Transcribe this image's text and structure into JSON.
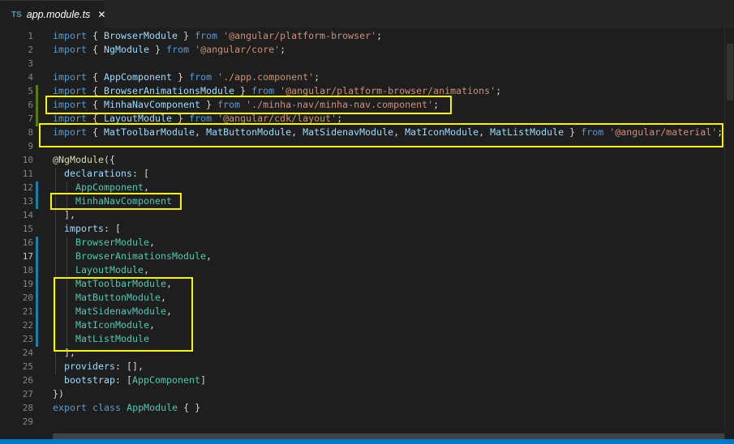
{
  "tab": {
    "lang_badge": "TS",
    "filename": "app.module.ts",
    "close_glyph": "✕"
  },
  "lines": [
    {
      "n": "1",
      "tokens": [
        [
          "k",
          "import"
        ],
        [
          "p",
          " { "
        ],
        [
          "v",
          "BrowserModule"
        ],
        [
          "p",
          " } "
        ],
        [
          "k",
          "from"
        ],
        [
          "p",
          " "
        ],
        [
          "s",
          "'@angular/platform-browser'"
        ],
        [
          "p",
          ";"
        ]
      ]
    },
    {
      "n": "2",
      "tokens": [
        [
          "k",
          "import"
        ],
        [
          "p",
          " { "
        ],
        [
          "v",
          "NgModule"
        ],
        [
          "p",
          " } "
        ],
        [
          "k",
          "from"
        ],
        [
          "p",
          " "
        ],
        [
          "s",
          "'@angular/core'"
        ],
        [
          "p",
          ";"
        ]
      ]
    },
    {
      "n": "3",
      "tokens": []
    },
    {
      "n": "4",
      "tokens": [
        [
          "k",
          "import"
        ],
        [
          "p",
          " { "
        ],
        [
          "v",
          "AppComponent"
        ],
        [
          "p",
          " } "
        ],
        [
          "k",
          "from"
        ],
        [
          "p",
          " "
        ],
        [
          "s",
          "'./app.component'"
        ],
        [
          "p",
          ";"
        ]
      ]
    },
    {
      "n": "5",
      "tokens": [
        [
          "k",
          "import"
        ],
        [
          "p",
          " { "
        ],
        [
          "v",
          "BrowserAnimationsModule"
        ],
        [
          "p",
          " } "
        ],
        [
          "k",
          "from"
        ],
        [
          "p",
          " "
        ],
        [
          "s",
          "'@angular/platform-browser/animations'"
        ],
        [
          "p",
          ";"
        ]
      ]
    },
    {
      "n": "6",
      "tokens": [
        [
          "k",
          "import"
        ],
        [
          "p",
          " { "
        ],
        [
          "v",
          "MinhaNavComponent"
        ],
        [
          "p",
          " } "
        ],
        [
          "k",
          "from"
        ],
        [
          "p",
          " "
        ],
        [
          "s",
          "'./minha-nav/minha-nav.component'"
        ],
        [
          "p",
          ";"
        ]
      ]
    },
    {
      "n": "7",
      "tokens": [
        [
          "k",
          "import"
        ],
        [
          "p",
          " { "
        ],
        [
          "v",
          "LayoutModule"
        ],
        [
          "p",
          " } "
        ],
        [
          "k",
          "from"
        ],
        [
          "p",
          " "
        ],
        [
          "s",
          "'@angular/cdk/layout'"
        ],
        [
          "p",
          ";"
        ]
      ]
    },
    {
      "n": "8",
      "tokens": [
        [
          "k",
          "import"
        ],
        [
          "p",
          " { "
        ],
        [
          "v",
          "MatToolbarModule"
        ],
        [
          "p",
          ", "
        ],
        [
          "v",
          "MatButtonModule"
        ],
        [
          "p",
          ", "
        ],
        [
          "v",
          "MatSidenavModule"
        ],
        [
          "p",
          ", "
        ],
        [
          "v",
          "MatIconModule"
        ],
        [
          "p",
          ", "
        ],
        [
          "v",
          "MatListModule"
        ],
        [
          "p",
          " } "
        ],
        [
          "k",
          "from"
        ],
        [
          "p",
          " "
        ],
        [
          "s",
          "'@angular/material'"
        ],
        [
          "p",
          ";"
        ]
      ]
    },
    {
      "n": "9",
      "tokens": []
    },
    {
      "n": "10",
      "tokens": [
        [
          "f",
          "@NgModule"
        ],
        [
          "p",
          "({"
        ]
      ]
    },
    {
      "n": "11",
      "tokens": [
        [
          "p",
          "  "
        ],
        [
          "v",
          "declarations"
        ],
        [
          "p",
          ": ["
        ]
      ]
    },
    {
      "n": "12",
      "tokens": [
        [
          "p",
          "    "
        ],
        [
          "t",
          "AppComponent"
        ],
        [
          "p",
          ","
        ]
      ]
    },
    {
      "n": "13",
      "tokens": [
        [
          "p",
          "    "
        ],
        [
          "t",
          "MinhaNavComponent"
        ]
      ]
    },
    {
      "n": "14",
      "tokens": [
        [
          "p",
          "  ],"
        ]
      ]
    },
    {
      "n": "15",
      "tokens": [
        [
          "p",
          "  "
        ],
        [
          "v",
          "imports"
        ],
        [
          "p",
          ": ["
        ]
      ]
    },
    {
      "n": "16",
      "tokens": [
        [
          "p",
          "    "
        ],
        [
          "t",
          "BrowserModule"
        ],
        [
          "p",
          ","
        ]
      ]
    },
    {
      "n": "17",
      "tokens": [
        [
          "p",
          "    "
        ],
        [
          "t",
          "BrowserAnimationsModule"
        ],
        [
          "p",
          ","
        ]
      ]
    },
    {
      "n": "18",
      "tokens": [
        [
          "p",
          "    "
        ],
        [
          "t",
          "LayoutModule"
        ],
        [
          "p",
          ","
        ]
      ]
    },
    {
      "n": "19",
      "tokens": [
        [
          "p",
          "    "
        ],
        [
          "t",
          "MatToolbarModule"
        ],
        [
          "p",
          ","
        ]
      ]
    },
    {
      "n": "20",
      "tokens": [
        [
          "p",
          "    "
        ],
        [
          "t",
          "MatButtonModule"
        ],
        [
          "p",
          ","
        ]
      ]
    },
    {
      "n": "21",
      "tokens": [
        [
          "p",
          "    "
        ],
        [
          "t",
          "MatSidenavModule"
        ],
        [
          "p",
          ","
        ]
      ]
    },
    {
      "n": "22",
      "tokens": [
        [
          "p",
          "    "
        ],
        [
          "t",
          "MatIconModule"
        ],
        [
          "p",
          ","
        ]
      ]
    },
    {
      "n": "23",
      "tokens": [
        [
          "p",
          "    "
        ],
        [
          "t",
          "MatListModule"
        ]
      ]
    },
    {
      "n": "24",
      "tokens": [
        [
          "p",
          "  ],"
        ]
      ]
    },
    {
      "n": "25",
      "tokens": [
        [
          "p",
          "  "
        ],
        [
          "v",
          "providers"
        ],
        [
          "p",
          ": [],"
        ]
      ]
    },
    {
      "n": "26",
      "tokens": [
        [
          "p",
          "  "
        ],
        [
          "v",
          "bootstrap"
        ],
        [
          "p",
          ": ["
        ],
        [
          "t",
          "AppComponent"
        ],
        [
          "p",
          "]"
        ]
      ]
    },
    {
      "n": "27",
      "tokens": [
        [
          "p",
          "})"
        ]
      ]
    },
    {
      "n": "28",
      "tokens": [
        [
          "k",
          "export"
        ],
        [
          "p",
          " "
        ],
        [
          "k",
          "class"
        ],
        [
          "p",
          " "
        ],
        [
          "t",
          "AppModule"
        ],
        [
          "p",
          " { }"
        ]
      ]
    },
    {
      "n": "29",
      "tokens": []
    }
  ],
  "active_line": "17",
  "colors": {
    "background": "#1e1e1e",
    "keyword": "#569cd6",
    "string": "#ce9178",
    "variable": "#9cdcfe",
    "type": "#4ec9b0",
    "decorator": "#dcdcaa",
    "highlight_box": "#f5f500",
    "statusbar": "#007acc"
  }
}
